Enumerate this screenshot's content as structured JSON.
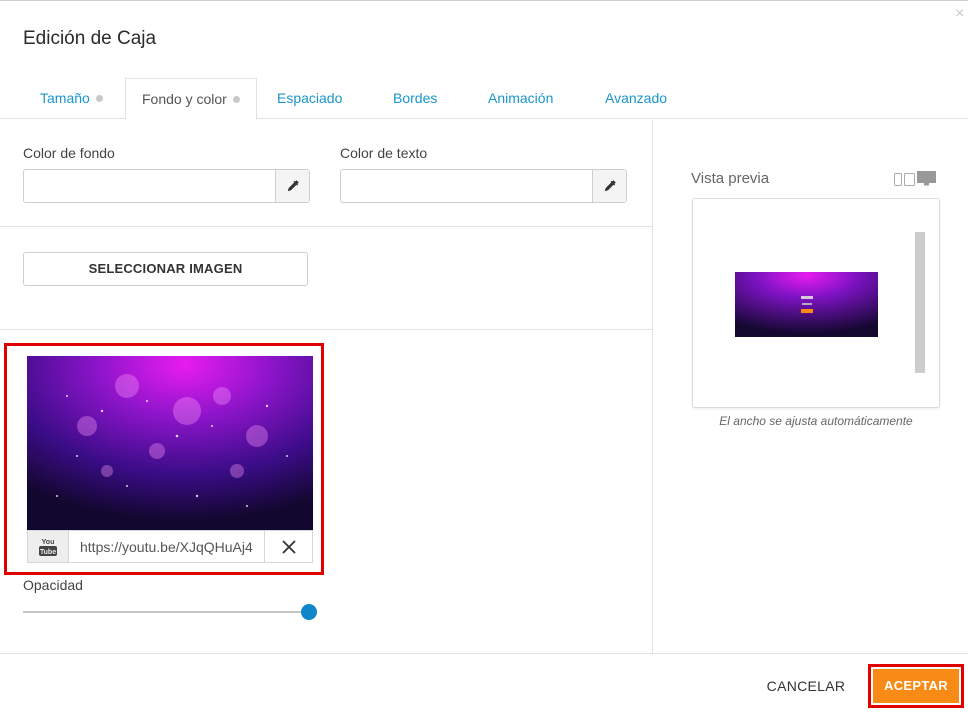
{
  "dialog": {
    "title": "Edición de Caja",
    "close_glyph": "×"
  },
  "tabs": [
    {
      "label": "Tamaño",
      "has_dot": true,
      "active": false
    },
    {
      "label": "Fondo y color",
      "has_dot": true,
      "active": true
    },
    {
      "label": "Espaciado",
      "has_dot": false,
      "active": false
    },
    {
      "label": "Bordes",
      "has_dot": false,
      "active": false
    },
    {
      "label": "Animación",
      "has_dot": false,
      "active": false
    },
    {
      "label": "Avanzado",
      "has_dot": false,
      "active": false
    }
  ],
  "background": {
    "bg_color_label": "Color de fondo",
    "bg_color_value": "",
    "text_color_label": "Color de texto",
    "text_color_value": "",
    "select_image_label": "SELECCIONAR IMAGEN",
    "video_url": "https://youtu.be/XJqQHuAj4",
    "video_icon_line1": "You",
    "video_icon_line2": "Tube",
    "opacity_label": "Opacidad",
    "opacity_value": 1.0
  },
  "preview": {
    "label": "Vista previa",
    "note": "El ancho se ajusta automáticamente",
    "icons": [
      "phone-icon",
      "tablet-icon",
      "desktop-icon"
    ]
  },
  "footer": {
    "cancel_label": "CANCELAR",
    "accept_label": "ACEPTAR"
  },
  "colors": {
    "accent_blue": "#1a96c9",
    "accept_orange": "#f88a16",
    "highlight_red": "#e00000",
    "slider_blue": "#0e86c9"
  }
}
